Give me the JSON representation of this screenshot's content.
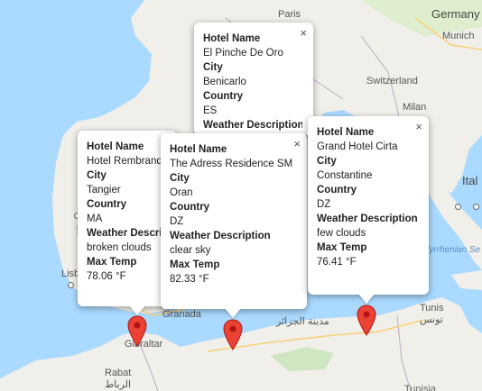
{
  "map": {
    "labels": [
      {
        "text": "Paris",
        "cls": "lbl"
      },
      {
        "text": "Germany",
        "cls": "lbl big"
      },
      {
        "text": "Munich",
        "cls": "lbl"
      },
      {
        "text": "Switzerland",
        "cls": "lbl"
      },
      {
        "text": "Milan",
        "cls": "lbl"
      },
      {
        "text": "Ital",
        "cls": "lbl big"
      },
      {
        "text": "Tyrrhenian Se",
        "cls": "lbl sea"
      },
      {
        "text": "Lisb",
        "cls": "lbl"
      },
      {
        "text": "Granada",
        "cls": "lbl"
      },
      {
        "text": "Gibraltar",
        "cls": "lbl"
      },
      {
        "text": "Rabat",
        "cls": "lbl"
      },
      {
        "text": "الرباط",
        "cls": "lbl"
      },
      {
        "text": "مدينة الجزائر",
        "cls": "lbl"
      },
      {
        "text": "Tunis",
        "cls": "lbl"
      },
      {
        "text": "تونس",
        "cls": "lbl"
      },
      {
        "text": "Tunisia",
        "cls": "lbl country"
      }
    ]
  },
  "popups": [
    {
      "close_icon": "×",
      "fields": [
        {
          "key": "Hotel Name",
          "value": "El Pinche De Oro"
        },
        {
          "key": "City",
          "value": "Benicarlo"
        },
        {
          "key": "Country",
          "value": "ES"
        },
        {
          "key": "Weather Description",
          "value": ""
        }
      ]
    },
    {
      "close_icon": "",
      "fields": [
        {
          "key": "Hotel Name",
          "value": "Hotel Rembrandt"
        },
        {
          "key": "City",
          "value": "Tangier"
        },
        {
          "key": "Country",
          "value": "MA"
        },
        {
          "key": "Weather Description",
          "value": "broken clouds"
        },
        {
          "key": "Max Temp",
          "value": "78.06 °F"
        }
      ]
    },
    {
      "close_icon": "×",
      "fields": [
        {
          "key": "Hotel Name",
          "value": "The Adress Residence SM"
        },
        {
          "key": "City",
          "value": "Oran"
        },
        {
          "key": "Country",
          "value": "DZ"
        },
        {
          "key": "Weather Description",
          "value": "clear sky"
        },
        {
          "key": "Max Temp",
          "value": "82.33 °F"
        }
      ]
    },
    {
      "close_icon": "×",
      "fields": [
        {
          "key": "Hotel Name",
          "value": "Grand Hotel Cirta"
        },
        {
          "key": "City",
          "value": "Constantine"
        },
        {
          "key": "Country",
          "value": "DZ"
        },
        {
          "key": "Weather Description",
          "value": "few clouds"
        },
        {
          "key": "Max Temp",
          "value": "76.41 °F"
        }
      ]
    }
  ],
  "colors": {
    "marker": "#ea4335",
    "water": "#aadaff",
    "land": "#f1efe9"
  }
}
